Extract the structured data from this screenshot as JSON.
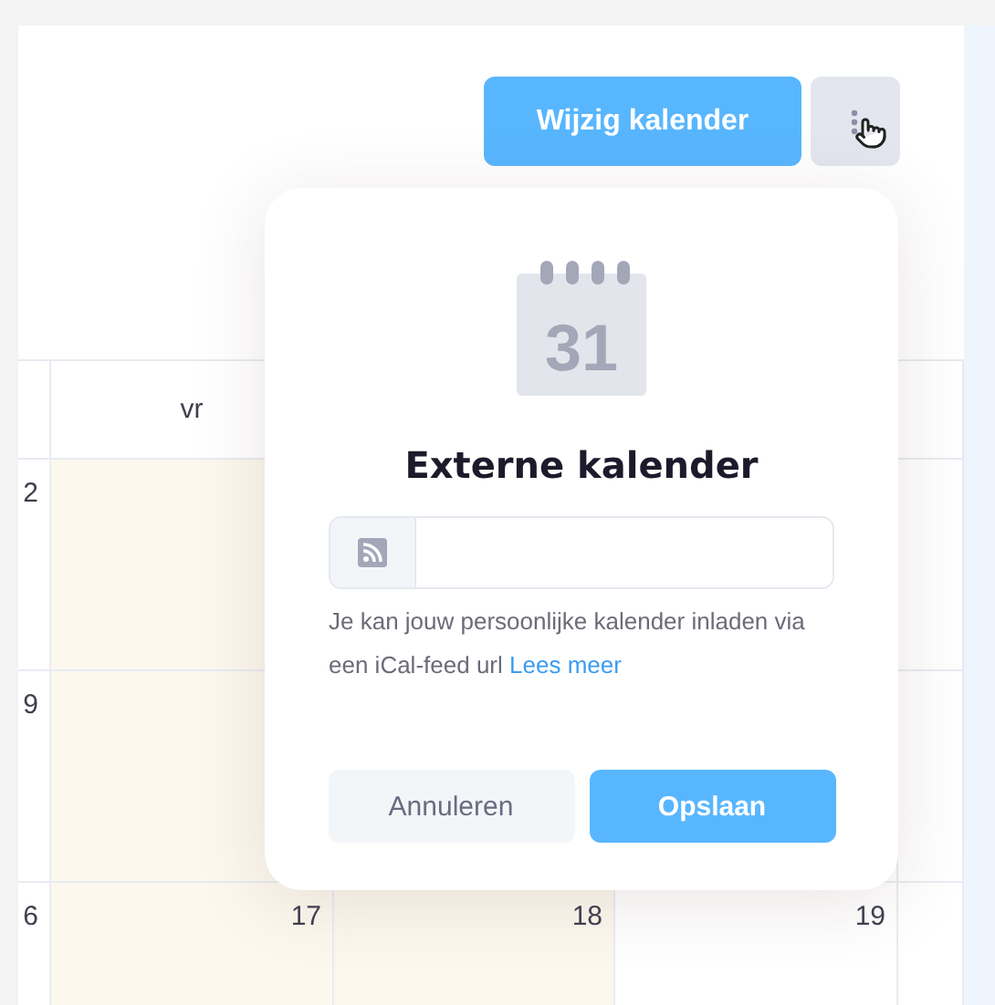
{
  "toolbar": {
    "edit_button": "Wijzig kalender",
    "more_button": {
      "hovered": true
    }
  },
  "calendar": {
    "weekday_header": "vr",
    "rows": [
      {
        "cells": [
          {
            "number": "2",
            "highlighted": false
          },
          {
            "highlighted": true
          }
        ]
      },
      {
        "cells": [
          {
            "number": "9",
            "highlighted": false
          },
          {
            "highlighted": true
          }
        ]
      },
      {
        "cells": [
          {
            "number": "6",
            "highlighted": false
          },
          {
            "number": "17",
            "highlighted": true
          },
          {
            "number": "18",
            "highlighted": true
          },
          {
            "number": "19",
            "highlighted": false
          }
        ]
      }
    ]
  },
  "dialog": {
    "icon_day": "31",
    "title": "Externe kalender",
    "help_text": "Je kan jouw persoonlijke kalender inladen via een iCal-feed url",
    "help_link": "Lees meer",
    "buttons": [
      {
        "label": "Annuleren",
        "kind": "secondary"
      },
      {
        "label": "Opslaan",
        "kind": "primary"
      }
    ]
  }
}
